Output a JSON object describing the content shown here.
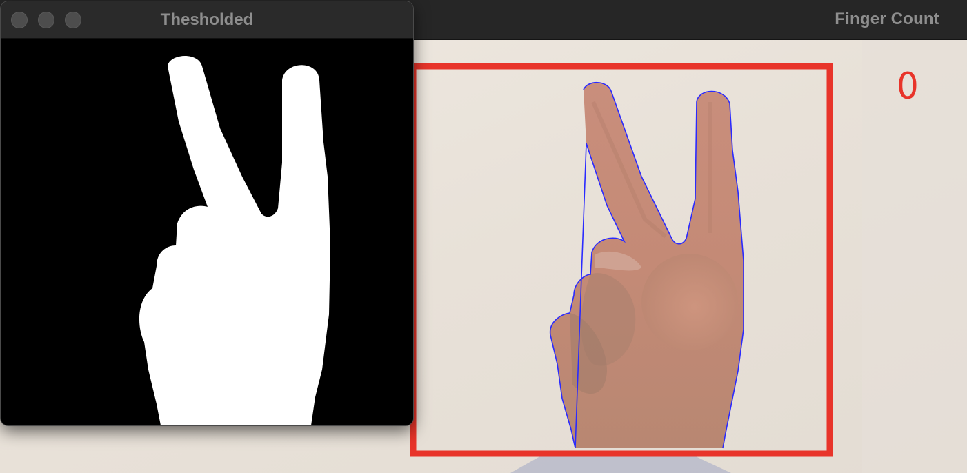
{
  "windows": {
    "finger_count": {
      "title": "Finger Count",
      "count_label": "0",
      "overlay_colors": {
        "roi_box": "#e8342a",
        "contour": "#2a2aff",
        "count_text": "#e8342a"
      }
    },
    "thresholded": {
      "title": "Thesholded",
      "traffic_lights": [
        "close",
        "minimize",
        "maximize"
      ]
    }
  }
}
